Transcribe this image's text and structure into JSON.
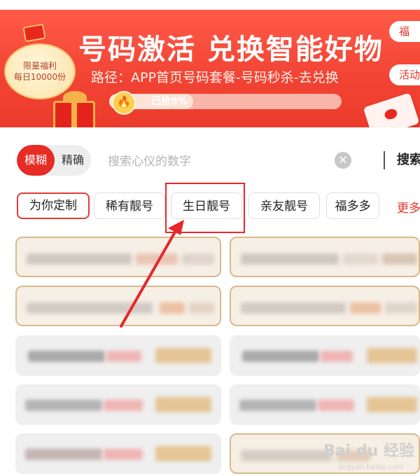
{
  "banner": {
    "title": "号码激活 兑换智能好物",
    "path": "路径：APP首页号码套餐-号码秒杀-去兑换",
    "badge_line1": "限量福利",
    "badge_line2": "每日10000份",
    "progress_label": "已抢9%",
    "progress_value": 0.09,
    "side_tab_top": "福",
    "side_tab_bottom": "活动"
  },
  "search": {
    "mode_fuzzy": "模糊",
    "mode_exact": "精确",
    "placeholder": "搜索心仪的数字",
    "submit_label": "搜索",
    "clear_icon": "close-icon"
  },
  "categories": [
    {
      "label": "为你定制",
      "active": true
    },
    {
      "label": "稀有靓号",
      "active": false
    },
    {
      "label": "生日靓号",
      "active": false,
      "highlighted": true
    },
    {
      "label": "亲友靓号",
      "active": false
    },
    {
      "label": "福多多",
      "active": false
    }
  ],
  "categories_more": "更多",
  "colors": {
    "brand_red": "#e62c25",
    "banner_red": "#f14333",
    "gold_border": "#d9b98c"
  },
  "watermark": {
    "logo": "Bai du 经验",
    "url": "jingyan.baidu.com"
  }
}
